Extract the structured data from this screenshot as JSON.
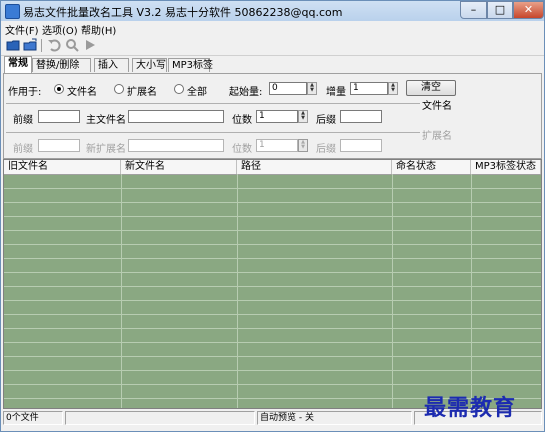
{
  "window": {
    "title": "易志文件批量改名工具 V3.2    易志十分软件  50862238@qq.com"
  },
  "menu": [
    {
      "label": "文件(F)"
    },
    {
      "label": "选项(O)"
    },
    {
      "label": "帮助(H)"
    }
  ],
  "tabs": [
    {
      "label": "常规"
    },
    {
      "label": "替换/删除"
    },
    {
      "label": "插入"
    },
    {
      "label": "大小写"
    },
    {
      "label": "MP3标签"
    }
  ],
  "apply": {
    "label": "作用于:",
    "options": [
      {
        "label": "文件名",
        "selected": true
      },
      {
        "label": "扩展名",
        "selected": false
      },
      {
        "label": "全部",
        "selected": false
      }
    ]
  },
  "start": {
    "label": "起始量:",
    "value": "0"
  },
  "increment": {
    "label": "增量",
    "value": "1"
  },
  "clear_label": "清空",
  "filename_group": {
    "title": "文件名",
    "prefix_label": "前缀",
    "prefix_value": "",
    "main_label": "主文件名",
    "main_value": "",
    "digits_label": "位数",
    "digits_value": "1",
    "suffix_label": "后缀",
    "suffix_value": ""
  },
  "extension_group": {
    "title": "扩展名",
    "prefix_label": "前缀",
    "main_label": "新扩展名",
    "digits_label": "位数",
    "digits_value": "1",
    "suffix_label": "后缀"
  },
  "grid": {
    "columns": [
      {
        "label": "旧文件名"
      },
      {
        "label": "新文件名"
      },
      {
        "label": "路径"
      },
      {
        "label": "命名状态"
      },
      {
        "label": "MP3标签状态"
      }
    ]
  },
  "status": {
    "file_count": "0个文件",
    "middle": "",
    "preview": "自动预览 - 关"
  },
  "watermark": "最需教育",
  "colors": {
    "grid_bg": "#8aa882",
    "grid_line": "#b7ccb1",
    "title_bar": "#cfe0f3"
  }
}
